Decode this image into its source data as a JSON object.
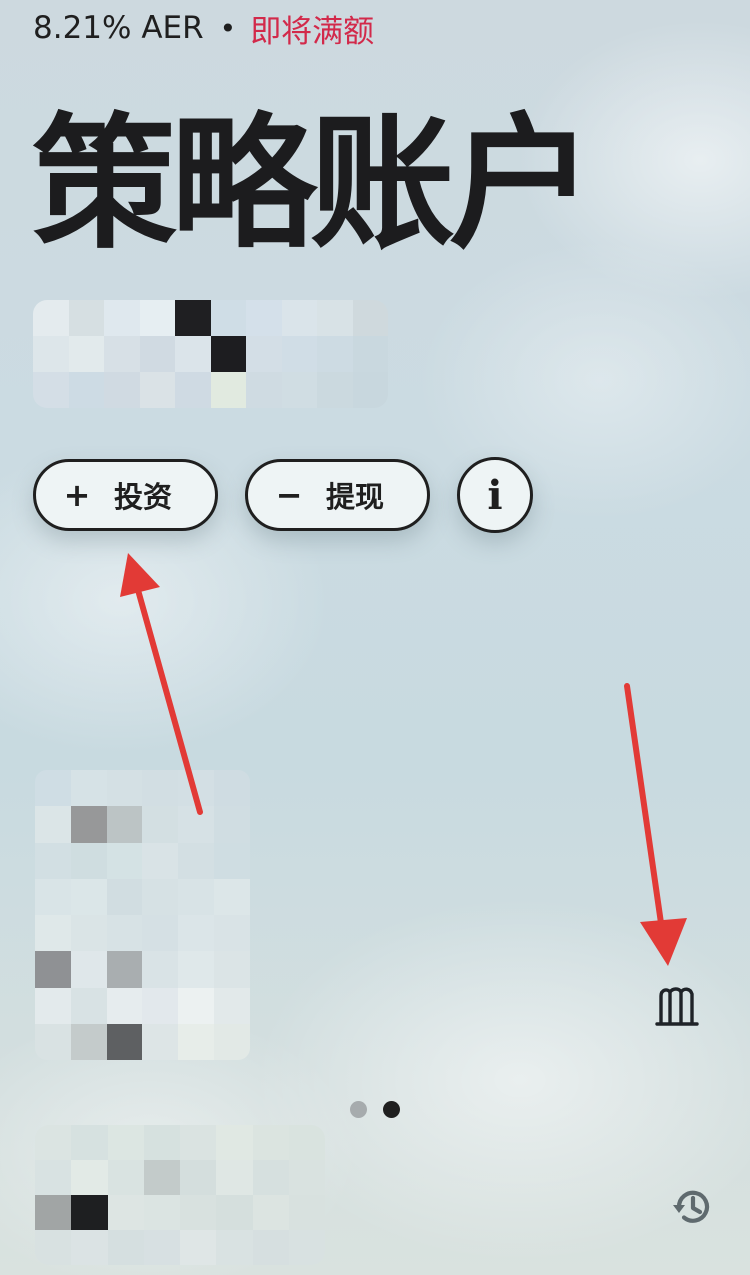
{
  "rate": {
    "value": "8.21% AER",
    "separator": "•",
    "status": "即将满额"
  },
  "title": "策略账户",
  "actions": {
    "invest": {
      "icon": "plus-icon",
      "sign": "+",
      "label": "投资"
    },
    "withdraw": {
      "icon": "minus-icon",
      "sign": "−",
      "label": "提现"
    },
    "info": {
      "icon": "info-icon",
      "glyph": "i"
    }
  },
  "pager": {
    "total": 2,
    "active_index": 1
  },
  "colors": {
    "status_red": "#d2294a",
    "text_dark": "#1f1f1f",
    "annotation_arrow": "#e23a36",
    "icon_gray": "#5f6a6e"
  },
  "icons": {
    "columns": "columns-icon",
    "history": "history-icon"
  }
}
